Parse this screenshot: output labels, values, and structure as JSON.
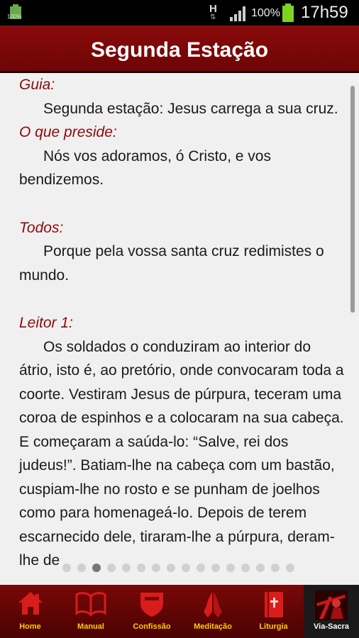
{
  "status_bar": {
    "left_battery_label": "100%",
    "network": "H",
    "network_arrows": "⇅",
    "battery_pct": "100%",
    "time": "17h59"
  },
  "title": "Segunda Estação",
  "content": {
    "blocks": [
      {
        "speaker": "Guia:",
        "text": "Segunda estação: Jesus carrega a sua cruz."
      },
      {
        "speaker": "O que preside:",
        "text": "Nós vos adoramos, ó Cristo, e vos bendizemos."
      },
      {
        "speaker": "Todos:",
        "text": "Porque pela vossa santa cruz redimistes o mundo."
      },
      {
        "speaker": "Leitor 1:",
        "text": "Os soldados o conduziram ao interior do átrio, isto é, ao pretório, onde convocaram toda a coorte. Vestiram Jesus de púrpura, teceram uma coroa de espinhos e a colocaram na sua cabeça. E começaram a saúda-lo: “Salve, rei dos judeus!”. Batiam-lhe na cabeça com um bastão, cuspiam-lhe no rosto e se punham de joelhos como para homenageá-lo. Depois de terem escarnecido dele, tiraram-lhe a púrpura, deram-lhe de"
      }
    ]
  },
  "page_indicator": {
    "count": 16,
    "current": 3
  },
  "nav": [
    {
      "label": "Home",
      "icon": "home-icon"
    },
    {
      "label": "Manual",
      "icon": "book-icon"
    },
    {
      "label": "Confissão",
      "icon": "shield-icon"
    },
    {
      "label": "Meditação",
      "icon": "praying-hands-icon"
    },
    {
      "label": "Liturgia",
      "icon": "bible-icon"
    },
    {
      "label": "Via-Sacra",
      "icon": "cross-bearing-icon",
      "active": true
    }
  ],
  "colors": {
    "accent": "#8b0a0a",
    "nav_label": "#ffcc00",
    "battery": "#7ed321"
  }
}
